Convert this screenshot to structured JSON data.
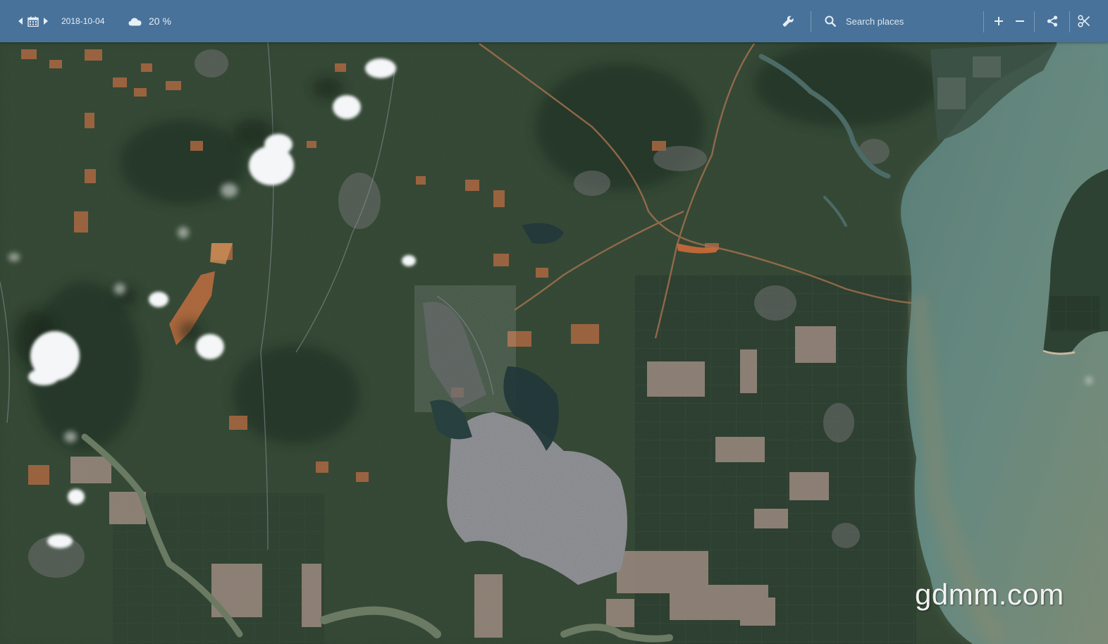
{
  "toolbar": {
    "date": "2018-10-04",
    "cloud_coverage": "20 %",
    "search_placeholder": "Search places",
    "icons": {
      "prev_date": "caret-left-icon",
      "calendar": "calendar-icon",
      "next_date": "caret-right-icon",
      "cloud": "cloud-icon",
      "tools": "wrench-icon",
      "search": "search-icon",
      "zoom_in": "plus-icon",
      "zoom_out": "minus-icon",
      "share": "share-icon",
      "collapse": "scissors-icon"
    }
  },
  "watermark": "gdmm.com",
  "colors": {
    "toolbar_bg": "#48729a",
    "toolbar_text": "#e6eef6",
    "land": "#2c3d2e",
    "sea": "#5e8883",
    "soil": "#b6663f"
  }
}
